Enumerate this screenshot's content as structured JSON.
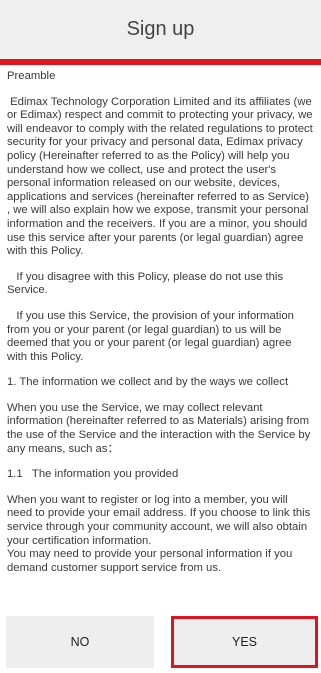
{
  "header": {
    "title": "Sign up"
  },
  "content": {
    "paragraphs": [
      "Preamble",
      " Edimax Technology Corporation Limited and its affiliates (we or Edimax) respect and commit to protecting your privacy, we will endeavor to comply with the related regulations to protect security for your privacy and personal data, Edimax privacy policy (Hereinafter referred to as the Policy) will help you understand how we collect, use and protect the user's personal information released on our website, devices, applications and services (hereinafter referred to as Service) , we will also explain how we expose, transmit your personal information and the receivers. If you are a minor, you should use this service after your parents (or legal guardian) agree with this Policy.",
      "   If you disagree with this Policy, please do not use this Service.",
      "   If you use this Service, the provision of your information from you or your parent (or legal guardian) to us will be deemed that you or your parent (or legal guardian) agree with this Policy.",
      "1. The information we collect and by the ways we collect",
      "When you use the Service, we may collect relevant information (hereinafter referred to as Materials) arising from the use of the Service and the interaction with the Service by any means, such as：",
      "1.1   The information you provided",
      "When you want to register or log into a member, you will need to provide your email address. If you choose to link this service through your community account, we will also obtain your certification information.\nYou may need to provide your personal information if you demand customer support service from us."
    ]
  },
  "footer": {
    "no_label": "NO",
    "yes_label": "YES"
  },
  "colors": {
    "accent": "#e0141e",
    "header_bg": "#efefef",
    "button_bg": "#eeeeee"
  }
}
